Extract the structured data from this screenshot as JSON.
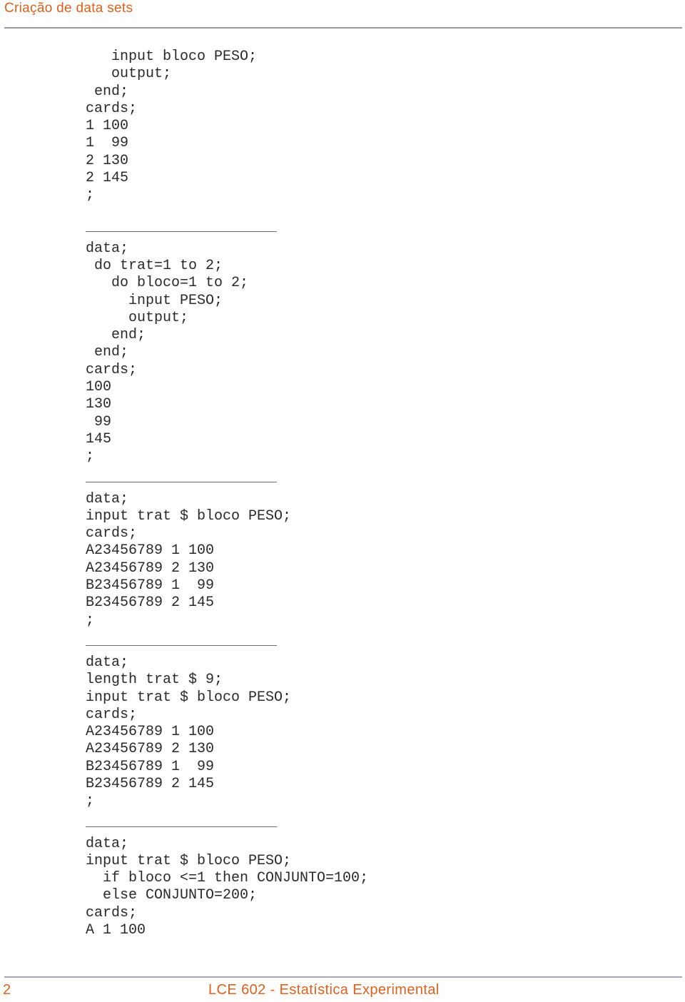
{
  "header": {
    "title": "Criação de data sets"
  },
  "code_blocks": [
    {
      "lines": [
        "   input bloco PESO;",
        "   output;",
        " end;",
        "cards;",
        "1 100",
        "1  99",
        "2 130",
        "2 145",
        ";"
      ]
    },
    {
      "lines": [
        "data;",
        " do trat=1 to 2;",
        "   do bloco=1 to 2;",
        "     input PESO;",
        "     output;",
        "   end;",
        " end;",
        "cards;",
        "100",
        "130",
        " 99",
        "145",
        ";"
      ]
    },
    {
      "lines": [
        "data;",
        "input trat $ bloco PESO;",
        "cards;",
        "A23456789 1 100",
        "A23456789 2 130",
        "B23456789 1  99",
        "B23456789 2 145",
        ";"
      ]
    },
    {
      "lines": [
        "data;",
        "length trat $ 9;",
        "input trat $ bloco PESO;",
        "cards;",
        "A23456789 1 100",
        "A23456789 2 130",
        "B23456789 1  99",
        "B23456789 2 145",
        ";"
      ]
    },
    {
      "lines": [
        "data;",
        "input trat $ bloco PESO;",
        "  if bloco <=1 then CONJUNTO=100;",
        "  else CONJUNTO=200;",
        "cards;",
        "A 1 100"
      ]
    }
  ],
  "footer": {
    "page_number": "2",
    "course_title": "LCE 602 - Estatística Experimental"
  },
  "colors": {
    "accent": "#e0601c",
    "code_text": "#2a2a2a",
    "rule": "#9a9a9a"
  }
}
